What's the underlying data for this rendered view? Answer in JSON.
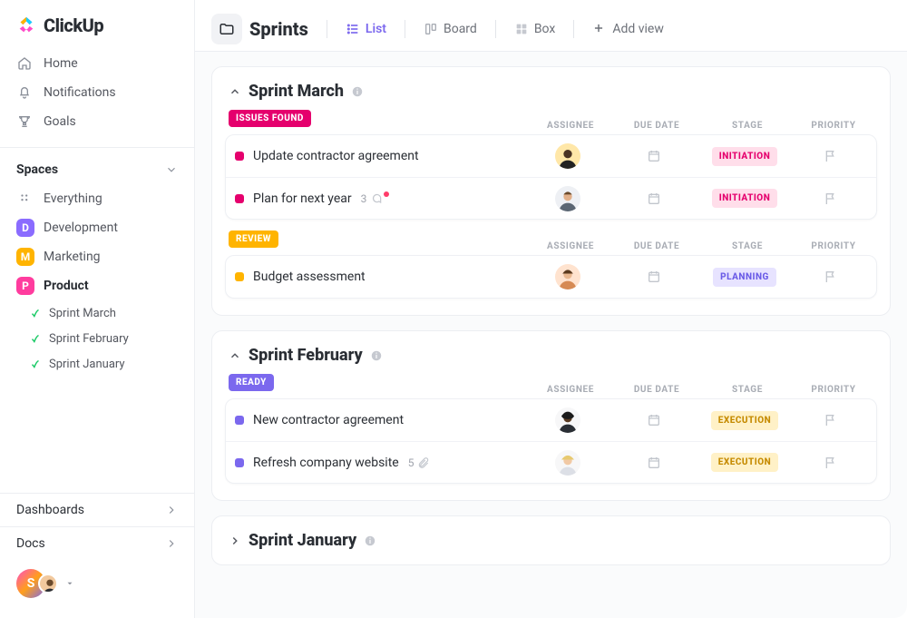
{
  "brand": {
    "name": "ClickUp"
  },
  "sidebar": {
    "nav": [
      {
        "label": "Home"
      },
      {
        "label": "Notifications"
      },
      {
        "label": "Goals"
      }
    ],
    "spaces_label": "Spaces",
    "everything_label": "Everything",
    "spaces": [
      {
        "letter": "D",
        "label": "Development"
      },
      {
        "letter": "M",
        "label": "Marketing"
      },
      {
        "letter": "P",
        "label": "Product"
      }
    ],
    "product_children": [
      {
        "label": "Sprint  March"
      },
      {
        "label": "Sprint  February"
      },
      {
        "label": "Sprint January"
      }
    ],
    "dashboards_label": "Dashboards",
    "docs_label": "Docs",
    "user_initial": "S"
  },
  "header": {
    "title": "Sprints",
    "views": [
      {
        "label": "List"
      },
      {
        "label": "Board"
      },
      {
        "label": "Box"
      },
      {
        "label": "Add view"
      }
    ]
  },
  "columns": {
    "assignee": "ASSIGNEE",
    "due": "DUE DATE",
    "stage": "STAGE",
    "priority": "PRIORITY"
  },
  "sprints": [
    {
      "title": "Sprint March",
      "expanded": true,
      "groups": [
        {
          "status": "ISSUES FOUND",
          "status_kind": "issues",
          "tasks": [
            {
              "title": "Update contractor agreement",
              "stage": "INITIATION",
              "stage_kind": "initiation",
              "avatar_bg": "#ffe7a8",
              "face": "dark"
            },
            {
              "title": "Plan for next year",
              "stage": "INITIATION",
              "stage_kind": "initiation",
              "comments": "3",
              "has_dot": true,
              "avatar_bg": "#eef0f4",
              "face": "light"
            }
          ]
        },
        {
          "status": "REVIEW",
          "status_kind": "review",
          "tasks": [
            {
              "title": "Budget assessment",
              "stage": "PLANNING",
              "stage_kind": "planning",
              "avatar_bg": "#ffe3cf",
              "face": "light"
            }
          ]
        }
      ]
    },
    {
      "title": "Sprint February",
      "expanded": true,
      "groups": [
        {
          "status": "READY",
          "status_kind": "ready",
          "tasks": [
            {
              "title": "New contractor agreement",
              "stage": "EXECUTION",
              "stage_kind": "execution",
              "avatar_bg": "#f7f7f8",
              "face": "dark-curly"
            },
            {
              "title": "Refresh company website",
              "stage": "EXECUTION",
              "stage_kind": "execution",
              "attachments": "5",
              "avatar_bg": "#f7f7f8",
              "face": "blonde"
            }
          ]
        }
      ]
    },
    {
      "title": "Sprint January",
      "expanded": false
    }
  ]
}
